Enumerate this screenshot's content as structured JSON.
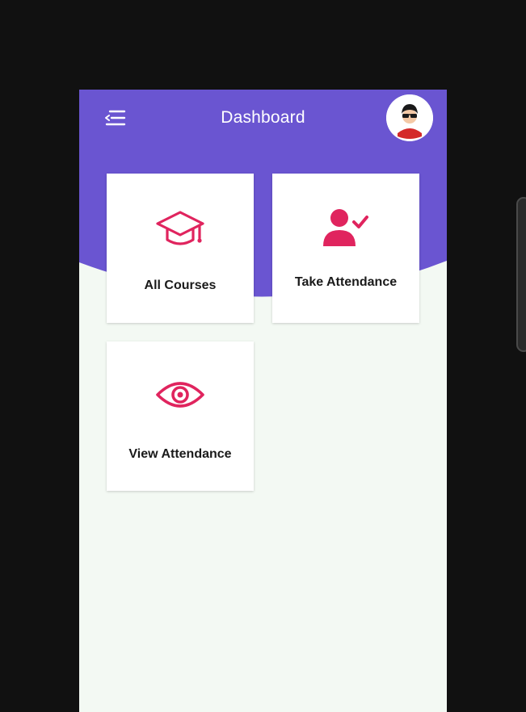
{
  "header": {
    "title": "Dashboard",
    "menu_icon": "menu-icon",
    "avatar_icon": "user-avatar"
  },
  "colors": {
    "header_bg": "#6a55d1",
    "content_bg": "#f3f9f3",
    "icon_accent": "#e0245e",
    "card_label": "#1a1a1a"
  },
  "cards": [
    {
      "label": "All Courses",
      "icon": "graduation-cap-icon"
    },
    {
      "label": "Take Attendance",
      "icon": "user-check-icon"
    },
    {
      "label": "View Attendance",
      "icon": "eye-icon"
    }
  ]
}
